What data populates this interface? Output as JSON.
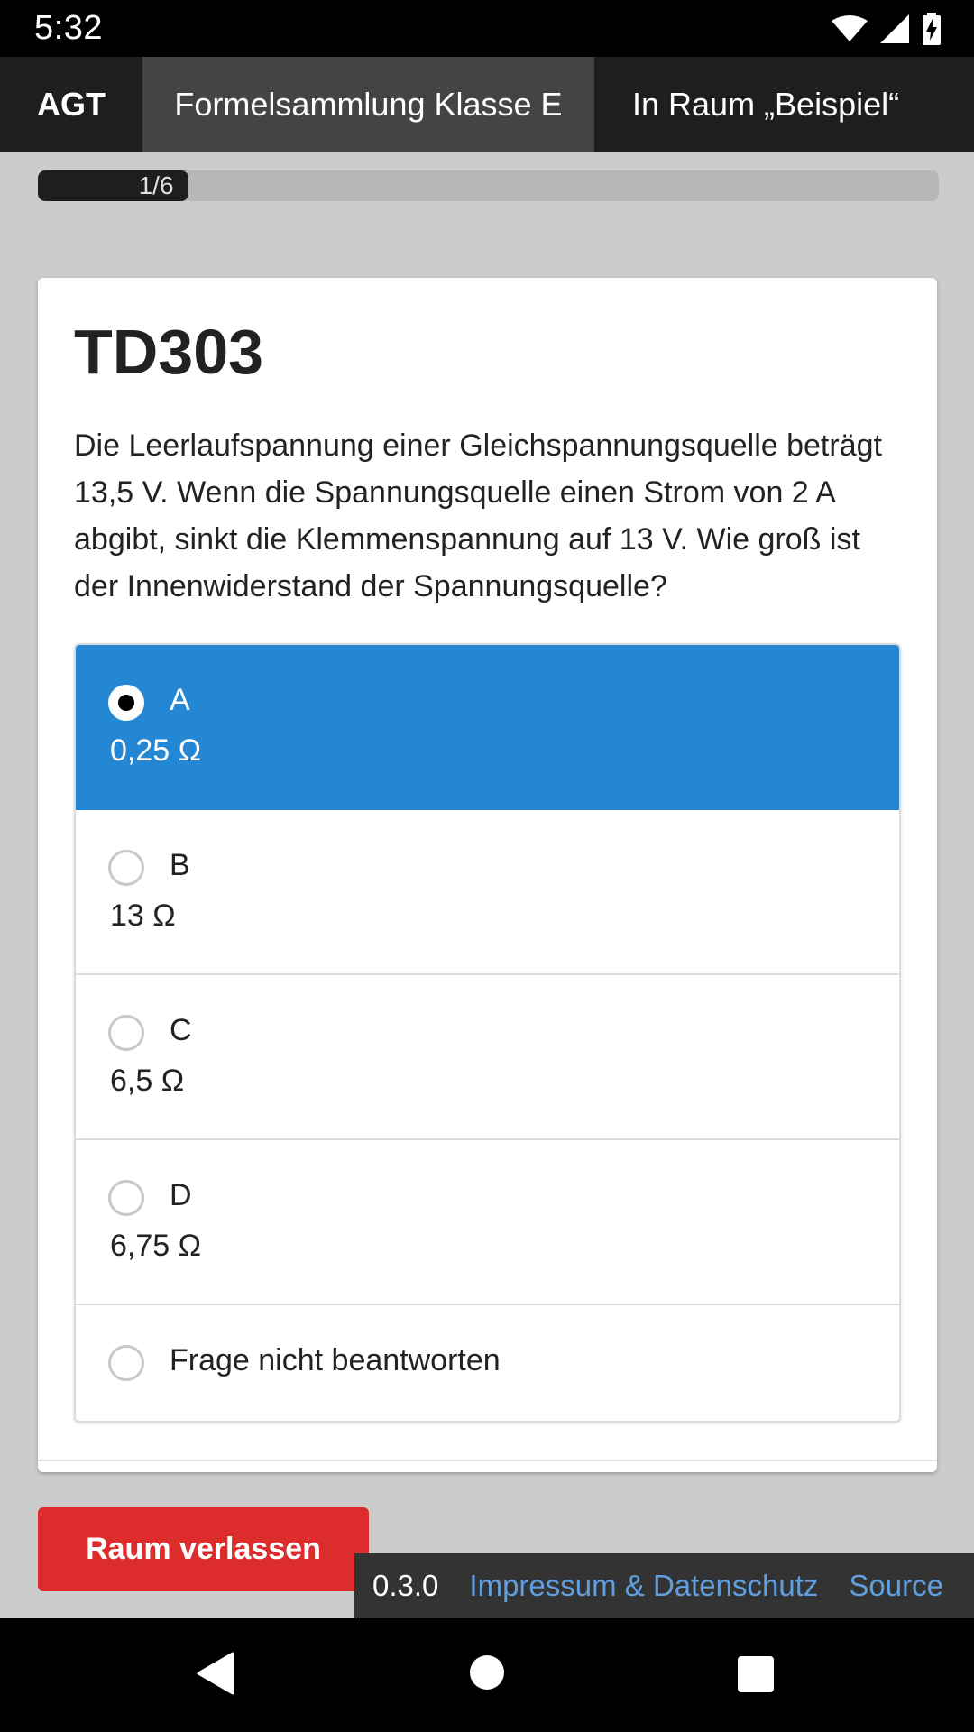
{
  "status_bar": {
    "time": "5:32",
    "icons": [
      "wifi-icon",
      "signal-icon",
      "battery-charging-icon"
    ]
  },
  "navbar": {
    "brand": "AGT",
    "active_tab": "Formelsammlung Klasse E",
    "room": "In Raum „Beispiel“"
  },
  "progress": {
    "label": "1/6",
    "fraction": 0.1667
  },
  "question": {
    "id": "TD303",
    "text": "Die Leerlaufspannung einer Gleichspannungsquelle beträgt 13,5 V. Wenn die Spannungsquelle einen Strom von 2 A abgibt, sinkt die Klemmenspannung auf 13 V. Wie groß ist der Innenwiderstand der Spannungsquelle?",
    "answers": [
      {
        "letter": "A",
        "value": "0,25 Ω",
        "selected": true
      },
      {
        "letter": "B",
        "value": "13 Ω",
        "selected": false
      },
      {
        "letter": "C",
        "value": "6,5 Ω",
        "selected": false
      },
      {
        "letter": "D",
        "value": "6,75 Ω",
        "selected": false
      }
    ],
    "skip_label": "Frage nicht beantworten"
  },
  "leave_button": "Raum verlassen",
  "footer": {
    "version": "0.3.0",
    "imprint": "Impressum & Datenschutz",
    "source": "Source"
  },
  "colors": {
    "accent": "#2387d4",
    "danger": "#dd2c2c",
    "navbar": "#1e1e1e",
    "background": "#cccccc"
  },
  "system_nav": [
    "back-icon",
    "home-icon",
    "recents-icon"
  ]
}
